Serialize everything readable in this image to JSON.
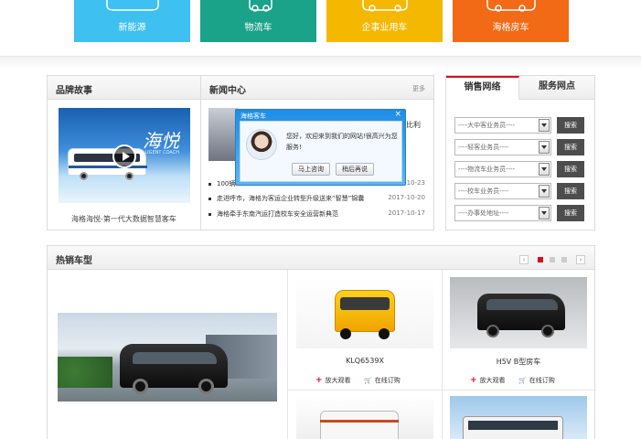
{
  "tiles": [
    {
      "label": "新能源",
      "color": "#3ec0f0"
    },
    {
      "label": "物流车",
      "color": "#1aa389"
    },
    {
      "label": "企事业用车",
      "color": "#f5b800"
    },
    {
      "label": "海格房车",
      "color": "#f26a16"
    }
  ],
  "brand": {
    "title": "品牌故事",
    "logo": "海悦",
    "logo_sub": "HAIYUE INTELLIGENT COACH",
    "caption": "海格海悦-第一代大数据智慧客车"
  },
  "news": {
    "title": "新闻中心",
    "more": "更多",
    "partial_text": "比利",
    "items": [
      {
        "title": "100辆",
        "date": "2017-10-23"
      },
      {
        "title": "走进呼市，海格为客运企业转型升级送来“智慧”锦囊",
        "date": "2017-10-20"
      },
      {
        "title": "海格牵手东南汽运打造校车安全运营新典范",
        "date": "2017-10-17"
      }
    ]
  },
  "popup": {
    "title": "海格客车",
    "close": "×",
    "message": "您好，欢迎来到我们的网站!很高兴为您服务!",
    "consult_btn": "马上咨询",
    "later_btn": "稍后再说"
  },
  "sales": {
    "tab_sales": "销售网络",
    "tab_service": "服务网点",
    "rows": [
      {
        "placeholder": "----大中客业务员----",
        "button": "搜索"
      },
      {
        "placeholder": "----轻客业务员----",
        "button": "搜索"
      },
      {
        "placeholder": "----物流车业务员----",
        "button": "搜索"
      },
      {
        "placeholder": "----校车业务员----",
        "button": "搜索"
      },
      {
        "placeholder": "----办事处地址----",
        "button": "搜索"
      }
    ]
  },
  "hot": {
    "title": "热销车型",
    "prev": "‹",
    "next": "›",
    "models": [
      {
        "name": "KLQ6539X",
        "zoom": "放大观看",
        "order": "在线订购"
      },
      {
        "name": "H5V B型房车",
        "zoom": "放大观看",
        "order": "在线订购"
      }
    ]
  },
  "colors": {
    "accent_red": "#d20f1e",
    "search_btn": "#4d4d4d",
    "popup_blue": "#1d8ee6"
  }
}
